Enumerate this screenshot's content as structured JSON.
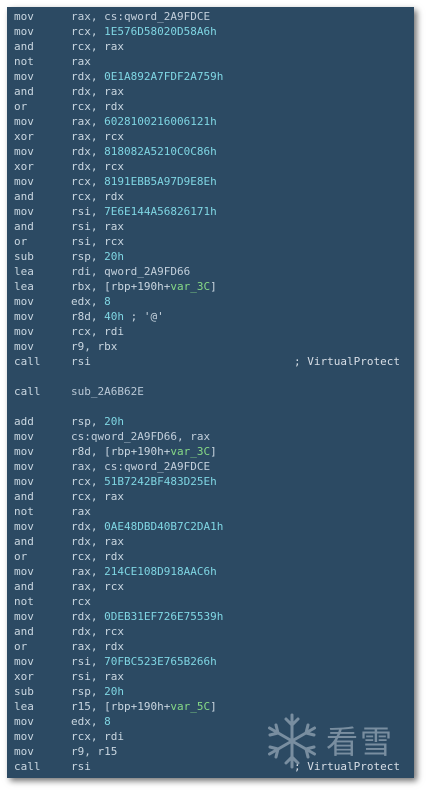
{
  "listing": [
    {
      "mnemonic": "mov",
      "tokens": [
        {
          "t": "rax, cs:qword_2A9FDCE",
          "c": "sym"
        }
      ]
    },
    {
      "mnemonic": "mov",
      "tokens": [
        {
          "t": "rcx, ",
          "c": "reg"
        },
        {
          "t": "1E576D58020D58A6h",
          "c": "hex"
        }
      ]
    },
    {
      "mnemonic": "and",
      "tokens": [
        {
          "t": "rcx, rax",
          "c": "reg"
        }
      ]
    },
    {
      "mnemonic": "not",
      "tokens": [
        {
          "t": "rax",
          "c": "reg"
        }
      ]
    },
    {
      "mnemonic": "mov",
      "tokens": [
        {
          "t": "rdx, ",
          "c": "reg"
        },
        {
          "t": "0E1A892A7FDF2A759h",
          "c": "hex"
        }
      ]
    },
    {
      "mnemonic": "and",
      "tokens": [
        {
          "t": "rdx, rax",
          "c": "reg"
        }
      ]
    },
    {
      "mnemonic": "or",
      "tokens": [
        {
          "t": "rcx, rdx",
          "c": "reg"
        }
      ]
    },
    {
      "mnemonic": "mov",
      "tokens": [
        {
          "t": "rax, ",
          "c": "reg"
        },
        {
          "t": "6028100216006121h",
          "c": "hex"
        }
      ]
    },
    {
      "mnemonic": "xor",
      "tokens": [
        {
          "t": "rax, rcx",
          "c": "reg"
        }
      ]
    },
    {
      "mnemonic": "mov",
      "tokens": [
        {
          "t": "rdx, ",
          "c": "reg"
        },
        {
          "t": "818082A5210C0C86h",
          "c": "hex"
        }
      ]
    },
    {
      "mnemonic": "xor",
      "tokens": [
        {
          "t": "rdx, rcx",
          "c": "reg"
        }
      ]
    },
    {
      "mnemonic": "mov",
      "tokens": [
        {
          "t": "rcx, ",
          "c": "reg"
        },
        {
          "t": "8191EBB5A97D9E8Eh",
          "c": "hex"
        }
      ]
    },
    {
      "mnemonic": "and",
      "tokens": [
        {
          "t": "rcx, rdx",
          "c": "reg"
        }
      ]
    },
    {
      "mnemonic": "mov",
      "tokens": [
        {
          "t": "rsi, ",
          "c": "reg"
        },
        {
          "t": "7E6E144A56826171h",
          "c": "hex"
        }
      ]
    },
    {
      "mnemonic": "and",
      "tokens": [
        {
          "t": "rsi, rax",
          "c": "reg"
        }
      ]
    },
    {
      "mnemonic": "or",
      "tokens": [
        {
          "t": "rsi, rcx",
          "c": "reg"
        }
      ]
    },
    {
      "mnemonic": "sub",
      "tokens": [
        {
          "t": "rsp, ",
          "c": "reg"
        },
        {
          "t": "20h",
          "c": "hex"
        }
      ]
    },
    {
      "mnemonic": "lea",
      "tokens": [
        {
          "t": "rdi, qword_2A9FD66",
          "c": "sym"
        }
      ]
    },
    {
      "mnemonic": "lea",
      "tokens": [
        {
          "t": "rbx, [rbp+190h+",
          "c": "reg"
        },
        {
          "t": "var_3C",
          "c": "var"
        },
        {
          "t": "]",
          "c": "reg"
        }
      ]
    },
    {
      "mnemonic": "mov",
      "tokens": [
        {
          "t": "edx, ",
          "c": "reg"
        },
        {
          "t": "8",
          "c": "hex"
        }
      ]
    },
    {
      "mnemonic": "mov",
      "tokens": [
        {
          "t": "r8d, ",
          "c": "reg"
        },
        {
          "t": "40h",
          "c": "hex"
        },
        {
          "t": " ; '@'",
          "c": "reg"
        }
      ]
    },
    {
      "mnemonic": "mov",
      "tokens": [
        {
          "t": "rcx, rdi",
          "c": "reg"
        }
      ]
    },
    {
      "mnemonic": "mov",
      "tokens": [
        {
          "t": "r9, rbx",
          "c": "reg"
        }
      ]
    },
    {
      "mnemonic": "call",
      "tokens": [
        {
          "t": "rsi",
          "c": "reg"
        }
      ],
      "comment": "; VirtualProtect"
    },
    {
      "blank": true
    },
    {
      "mnemonic": "call",
      "tokens": [
        {
          "t": "sub_2A6B62E",
          "c": "sub"
        }
      ]
    },
    {
      "blank": true
    },
    {
      "mnemonic": "add",
      "tokens": [
        {
          "t": "rsp, ",
          "c": "reg"
        },
        {
          "t": "20h",
          "c": "hex"
        }
      ]
    },
    {
      "mnemonic": "mov",
      "tokens": [
        {
          "t": "cs:qword_2A9FD66, rax",
          "c": "sym"
        }
      ]
    },
    {
      "mnemonic": "mov",
      "tokens": [
        {
          "t": "r8d, [rbp+190h+",
          "c": "reg"
        },
        {
          "t": "var_3C",
          "c": "var"
        },
        {
          "t": "]",
          "c": "reg"
        }
      ]
    },
    {
      "mnemonic": "mov",
      "tokens": [
        {
          "t": "rax, cs:qword_2A9FDCE",
          "c": "sym"
        }
      ]
    },
    {
      "mnemonic": "mov",
      "tokens": [
        {
          "t": "rcx, ",
          "c": "reg"
        },
        {
          "t": "51B7242BF483D25Eh",
          "c": "hex"
        }
      ]
    },
    {
      "mnemonic": "and",
      "tokens": [
        {
          "t": "rcx, rax",
          "c": "reg"
        }
      ]
    },
    {
      "mnemonic": "not",
      "tokens": [
        {
          "t": "rax",
          "c": "reg"
        }
      ]
    },
    {
      "mnemonic": "mov",
      "tokens": [
        {
          "t": "rdx, ",
          "c": "reg"
        },
        {
          "t": "0AE48DBD40B7C2DA1h",
          "c": "hex"
        }
      ]
    },
    {
      "mnemonic": "and",
      "tokens": [
        {
          "t": "rdx, rax",
          "c": "reg"
        }
      ]
    },
    {
      "mnemonic": "or",
      "tokens": [
        {
          "t": "rcx, rdx",
          "c": "reg"
        }
      ]
    },
    {
      "mnemonic": "mov",
      "tokens": [
        {
          "t": "rax, ",
          "c": "reg"
        },
        {
          "t": "214CE108D918AAC6h",
          "c": "hex"
        }
      ]
    },
    {
      "mnemonic": "and",
      "tokens": [
        {
          "t": "rax, rcx",
          "c": "reg"
        }
      ]
    },
    {
      "mnemonic": "not",
      "tokens": [
        {
          "t": "rcx",
          "c": "reg"
        }
      ]
    },
    {
      "mnemonic": "mov",
      "tokens": [
        {
          "t": "rdx, ",
          "c": "reg"
        },
        {
          "t": "0DEB31EF726E75539h",
          "c": "hex"
        }
      ]
    },
    {
      "mnemonic": "and",
      "tokens": [
        {
          "t": "rdx, rcx",
          "c": "reg"
        }
      ]
    },
    {
      "mnemonic": "or",
      "tokens": [
        {
          "t": "rax, rdx",
          "c": "reg"
        }
      ]
    },
    {
      "mnemonic": "mov",
      "tokens": [
        {
          "t": "rsi, ",
          "c": "reg"
        },
        {
          "t": "70FBC523E765B266h",
          "c": "hex"
        }
      ]
    },
    {
      "mnemonic": "xor",
      "tokens": [
        {
          "t": "rsi, rax",
          "c": "reg"
        }
      ]
    },
    {
      "mnemonic": "sub",
      "tokens": [
        {
          "t": "rsp, ",
          "c": "reg"
        },
        {
          "t": "20h",
          "c": "hex"
        }
      ]
    },
    {
      "mnemonic": "lea",
      "tokens": [
        {
          "t": "r15, [rbp+190h+",
          "c": "reg"
        },
        {
          "t": "var_5C",
          "c": "var"
        },
        {
          "t": "]",
          "c": "reg"
        }
      ]
    },
    {
      "mnemonic": "mov",
      "tokens": [
        {
          "t": "edx, ",
          "c": "reg"
        },
        {
          "t": "8",
          "c": "hex"
        }
      ]
    },
    {
      "mnemonic": "mov",
      "tokens": [
        {
          "t": "rcx, rdi",
          "c": "reg"
        }
      ]
    },
    {
      "mnemonic": "mov",
      "tokens": [
        {
          "t": "r9, r15",
          "c": "reg"
        }
      ]
    },
    {
      "mnemonic": "call",
      "tokens": [
        {
          "t": "rsi",
          "c": "reg"
        }
      ],
      "comment": "; VirtualProtect"
    }
  ],
  "watermark": {
    "icon": "snowflake-icon",
    "text": "看雪"
  },
  "colors": {
    "background": "#2c4a63",
    "text": "#c9d6e0",
    "hex_literal": "#7fd6e3",
    "variable": "#86d986"
  }
}
